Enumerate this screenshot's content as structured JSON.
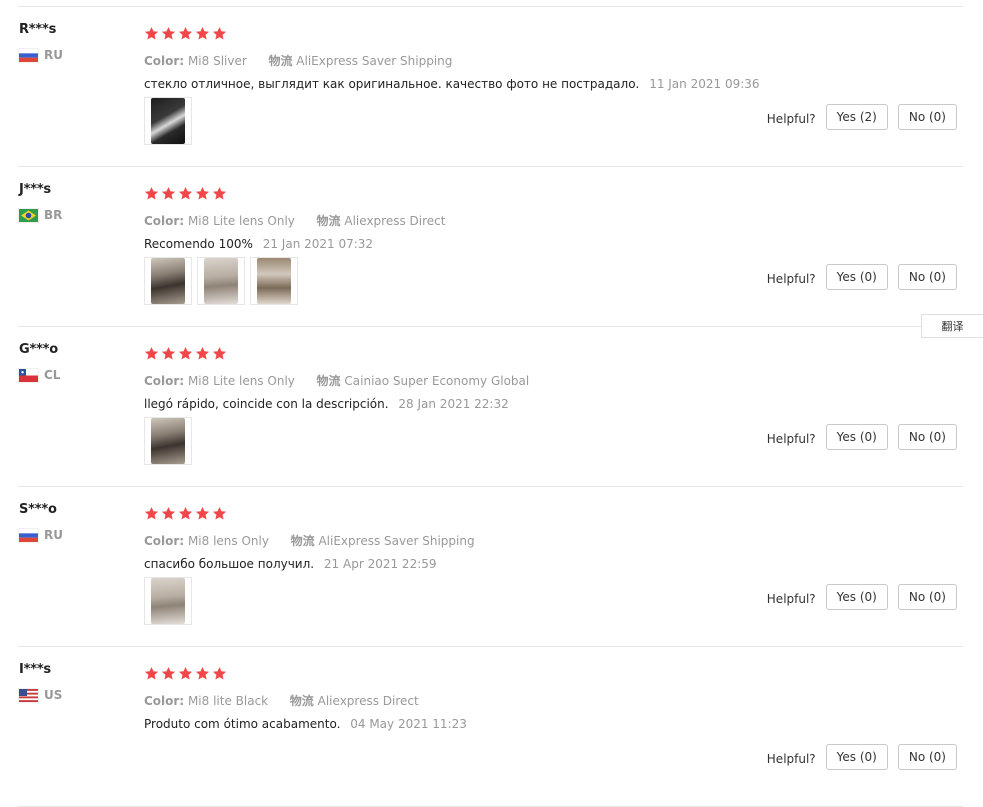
{
  "helpful_label": "Helpful?",
  "translate_label": "翻译",
  "star_color": "#f04848",
  "reviews": [
    {
      "user": "R***s",
      "country": "RU",
      "flag": "ru",
      "rating": 5,
      "color_label": "Color:",
      "color_value": "Mi8 Sliver",
      "shipping_label": "物流",
      "shipping_value": "AliExpress Saver Shipping",
      "text": "стекло отличное, выглядит как оригинальное. качество фото не пострадало.",
      "date": "11 Jan 2021 09:36",
      "photo_count": 1,
      "yes_label": "Yes (2)",
      "no_label": "No (0)"
    },
    {
      "user": "J***s",
      "country": "BR",
      "flag": "br",
      "rating": 5,
      "color_label": "Color:",
      "color_value": "Mi8 Lite lens Only",
      "shipping_label": "物流",
      "shipping_value": "Aliexpress Direct",
      "text": "Recomendo 100%",
      "date": "21 Jan 2021 07:32",
      "photo_count": 3,
      "yes_label": "Yes (0)",
      "no_label": "No (0)"
    },
    {
      "user": "G***o",
      "country": "CL",
      "flag": "cl",
      "rating": 5,
      "color_label": "Color:",
      "color_value": "Mi8 Lite lens Only",
      "shipping_label": "物流",
      "shipping_value": "Cainiao Super Economy Global",
      "text": "llegó rápido, coincide con la descripción.",
      "date": "28 Jan 2021 22:32",
      "photo_count": 1,
      "yes_label": "Yes (0)",
      "no_label": "No (0)"
    },
    {
      "user": "S***o",
      "country": "RU",
      "flag": "ru",
      "rating": 5,
      "color_label": "Color:",
      "color_value": "Mi8 lens Only",
      "shipping_label": "物流",
      "shipping_value": "AliExpress Saver Shipping",
      "text": "спасибо большое получил.",
      "date": "21 Apr 2021 22:59",
      "photo_count": 1,
      "yes_label": "Yes (0)",
      "no_label": "No (0)"
    },
    {
      "user": "I***s",
      "country": "US",
      "flag": "us",
      "rating": 5,
      "color_label": "Color:",
      "color_value": "Mi8 lite Black",
      "shipping_label": "物流",
      "shipping_value": "Aliexpress Direct",
      "text": "Produto com ótimo acabamento.",
      "date": "04 May 2021 11:23",
      "photo_count": 0,
      "yes_label": "Yes (0)",
      "no_label": "No (0)"
    }
  ]
}
